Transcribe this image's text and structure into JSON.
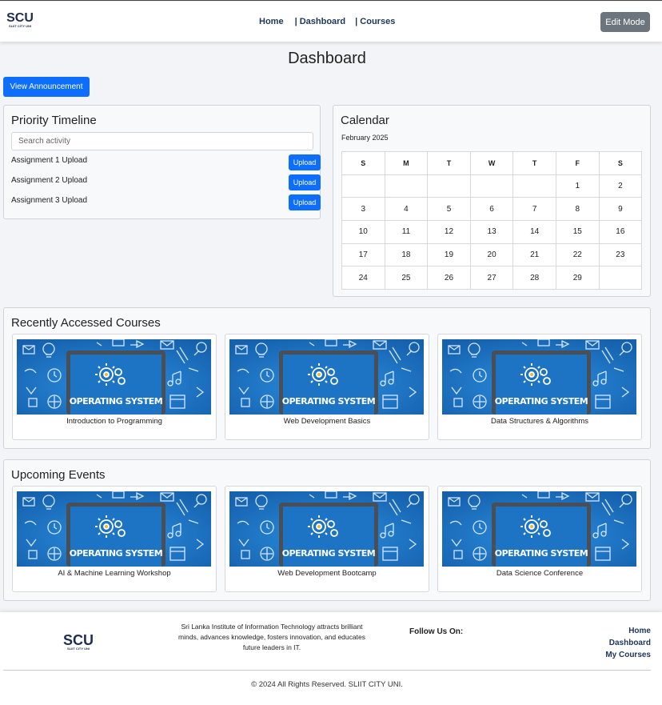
{
  "header": {
    "logo": {
      "text": "SCU",
      "subtext": "SLIIT CITY UNI"
    },
    "nav": [
      {
        "label": "Home"
      },
      {
        "label": "| Dashboard"
      },
      {
        "label": "| Courses"
      }
    ],
    "edit_mode_label": "Edit Mode"
  },
  "page_title": "Dashboard",
  "announcement_button": "View Announcement",
  "priority_timeline": {
    "title": "Priority Timeline",
    "search_placeholder": "Search activity",
    "tasks": [
      {
        "label": "Assignment 1 Upload",
        "button": "Upload"
      },
      {
        "label": "Assignment 2 Upload",
        "button": "Upload"
      },
      {
        "label": "Assignment 3 Upload",
        "button": "Upload"
      }
    ]
  },
  "calendar": {
    "title": "Calendar",
    "month": "February 2025",
    "weekdays": [
      "S",
      "M",
      "T",
      "W",
      "T",
      "F",
      "S"
    ],
    "weeks": [
      [
        "",
        "",
        "",
        "",
        "",
        "1",
        "2"
      ],
      [
        "3",
        "4",
        "5",
        "6",
        "7",
        "8",
        "9"
      ],
      [
        "10",
        "11",
        "12",
        "13",
        "14",
        "15",
        "16"
      ],
      [
        "17",
        "18",
        "19",
        "20",
        "21",
        "22",
        "23"
      ],
      [
        "24",
        "25",
        "26",
        "27",
        "28",
        "29",
        ""
      ]
    ]
  },
  "recent_courses": {
    "title": "Recently Accessed Courses",
    "items": [
      {
        "caption": "Introduction to Programming",
        "thumb_text": "OPERATING SYSTEM"
      },
      {
        "caption": "Web Development Basics",
        "thumb_text": "OPERATING SYSTEM"
      },
      {
        "caption": "Data Structures & Algorithms",
        "thumb_text": "OPERATING SYSTEM"
      }
    ]
  },
  "upcoming_events": {
    "title": "Upcoming Events",
    "items": [
      {
        "caption": "AI & Machine Learning Workshop",
        "thumb_text": "OPERATING SYSTEM"
      },
      {
        "caption": "Web Development Bootcamp",
        "thumb_text": "OPERATING SYSTEM"
      },
      {
        "caption": "Data Science Conference",
        "thumb_text": "OPERATING SYSTEM"
      }
    ]
  },
  "footer": {
    "logo": {
      "text": "SCU",
      "subtext": "SLIIT CITY UNI"
    },
    "about": "Sri Lanka Institute of Information Technology attracts brilliant minds, advances knowledge, fosters innovation, and educates future leaders in IT.",
    "follow_label": "Follow Us On:",
    "links": [
      "Home",
      "Dashboard",
      "My Courses"
    ],
    "copyright": "© 2024 All Rights Reserved. SLIIT CITY UNI."
  },
  "colors": {
    "primary": "#0d6efd",
    "secondary": "#6c757d",
    "nav_text": "#1d3557",
    "thumb_bg": "#1a6dc0"
  }
}
